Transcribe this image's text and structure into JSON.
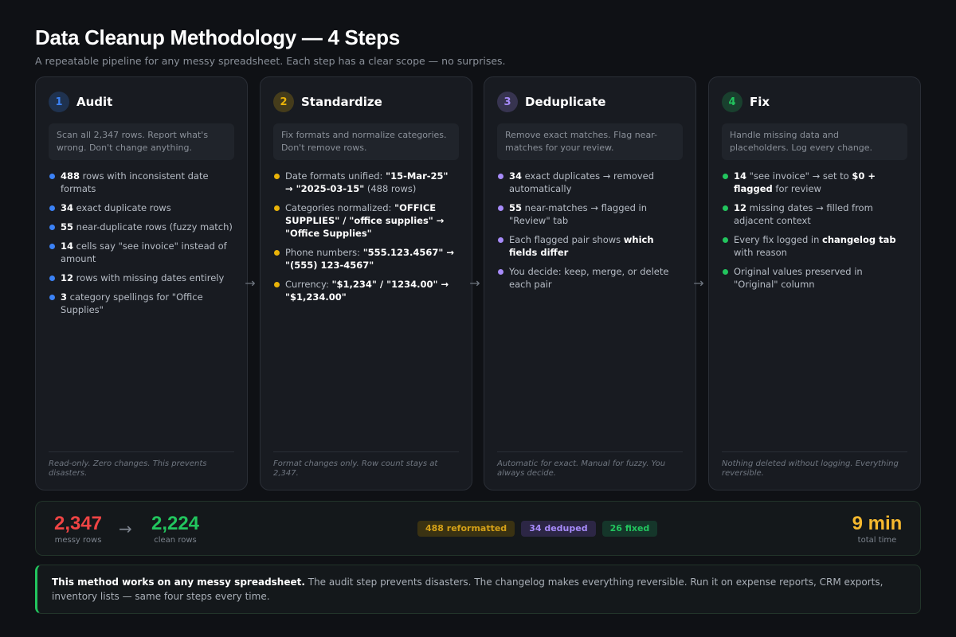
{
  "header": {
    "title": "Data Cleanup Methodology — 4 Steps",
    "subtitle": "A repeatable pipeline for any messy spreadsheet. Each step has a clear scope — no surprises."
  },
  "colors": {
    "audit": "#3b82f6",
    "standardize": "#eab308",
    "deduplicate": "#a78bfa",
    "fix": "#22c55e",
    "messy": "#ef4444",
    "clean": "#22c55e",
    "time": "#f5b82e"
  },
  "steps": [
    {
      "number": "1",
      "title": "Audit",
      "scope": "Scan all 2,347 rows. Report what's wrong. Don't change anything.",
      "bullets": [
        [
          {
            "b": "488"
          },
          {
            "t": " rows with inconsistent date formats"
          }
        ],
        [
          {
            "b": "34"
          },
          {
            "t": " exact duplicate rows"
          }
        ],
        [
          {
            "b": "55"
          },
          {
            "t": " near-duplicate rows (fuzzy match)"
          }
        ],
        [
          {
            "b": "14"
          },
          {
            "t": " cells say \"see invoice\" instead of amount"
          }
        ],
        [
          {
            "b": "12"
          },
          {
            "t": " rows with missing dates entirely"
          }
        ],
        [
          {
            "b": "3"
          },
          {
            "t": " category spellings for \"Office Supplies\""
          }
        ]
      ],
      "footer": "Read-only. Zero changes. This prevents disasters."
    },
    {
      "number": "2",
      "title": "Standardize",
      "scope": "Fix formats and normalize categories. Don't remove rows.",
      "bullets": [
        [
          {
            "t": "Date formats unified: "
          },
          {
            "b": "\"15-Mar-25\" → \"2025-03-15\""
          },
          {
            "t": " (488 rows)"
          }
        ],
        [
          {
            "t": "Categories normalized: "
          },
          {
            "b": "\"OFFICE SUPPLIES\" / \"office supplies\" → \"Office Supplies\""
          }
        ],
        [
          {
            "t": "Phone numbers: "
          },
          {
            "b": "\"555.123.4567\" → \"(555) 123-4567\""
          }
        ],
        [
          {
            "t": "Currency: "
          },
          {
            "b": "\"$1,234\" / \"1234.00\" → \"$1,234.00\""
          }
        ]
      ],
      "footer": "Format changes only. Row count stays at 2,347."
    },
    {
      "number": "3",
      "title": "Deduplicate",
      "scope": "Remove exact matches. Flag near-matches for your review.",
      "bullets": [
        [
          {
            "b": "34"
          },
          {
            "t": " exact duplicates → removed automatically"
          }
        ],
        [
          {
            "b": "55"
          },
          {
            "t": " near-matches → flagged in \"Review\" tab"
          }
        ],
        [
          {
            "t": "Each flagged pair shows "
          },
          {
            "b": "which fields differ"
          }
        ],
        [
          {
            "t": "You decide: keep, merge, or delete each pair"
          }
        ]
      ],
      "footer": "Automatic for exact. Manual for fuzzy. You always decide."
    },
    {
      "number": "4",
      "title": "Fix",
      "scope": "Handle missing data and placeholders. Log every change.",
      "bullets": [
        [
          {
            "b": "14"
          },
          {
            "t": " \"see invoice\" → set to "
          },
          {
            "b": "$0 + flagged"
          },
          {
            "t": " for review"
          }
        ],
        [
          {
            "b": "12"
          },
          {
            "t": " missing dates → filled from adjacent context"
          }
        ],
        [
          {
            "t": "Every fix logged in "
          },
          {
            "b": "changelog tab"
          },
          {
            "t": " with reason"
          }
        ],
        [
          {
            "t": "Original values preserved in \"Original\" column"
          }
        ]
      ],
      "footer": "Nothing deleted without logging. Everything reversible."
    }
  ],
  "summary": {
    "messy_value": "2,347",
    "messy_label": "messy rows",
    "clean_value": "2,224",
    "clean_label": "clean rows",
    "badges": [
      {
        "label": "488 reformatted",
        "color": "#d4a017",
        "bg": "#3a3212"
      },
      {
        "label": "34 deduped",
        "color": "#a78bfa",
        "bg": "#2c2645"
      },
      {
        "label": "26 fixed",
        "color": "#22c55e",
        "bg": "#15362a"
      }
    ],
    "time_value": "9 min",
    "time_label": "total time"
  },
  "note": {
    "strong": "This method works on any messy spreadsheet.",
    "text": " The audit step prevents disasters. The changelog makes everything reversible. Run it on expense reports, CRM exports, inventory lists — same four steps every time."
  }
}
